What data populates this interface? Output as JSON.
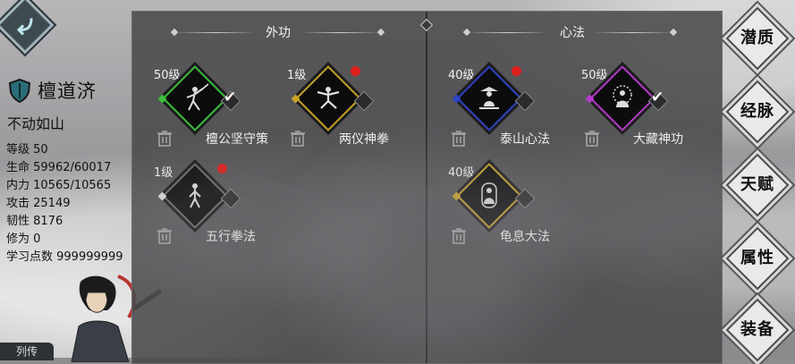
{
  "character": {
    "name": "檀道济",
    "title": "不动如山",
    "stats": [
      "等级 50",
      "生命 59962/60017",
      "内力 10565/10565",
      "攻击 25149",
      "韧性 8176",
      "修为 0",
      "学习点数 999999999"
    ],
    "bottom_label": "列传"
  },
  "sections": {
    "left_title": "外功",
    "right_title": "心法"
  },
  "skills": [
    {
      "level": "50级",
      "name": "檀公坚守策",
      "frame_color": "#3bbf3b",
      "equipped": true,
      "new": false
    },
    {
      "level": "1级",
      "name": "两仪神拳",
      "frame_color": "#c9a227",
      "equipped": false,
      "new": true
    },
    {
      "level": "1级",
      "name": "五行拳法",
      "frame_color": "#6d6d6d",
      "equipped": false,
      "new": true
    },
    {
      "level": "40级",
      "name": "泰山心法",
      "frame_color": "#2f43c4",
      "equipped": false,
      "new": true
    },
    {
      "level": "50级",
      "name": "大藏神功",
      "frame_color": "#b43bc9",
      "equipped": true,
      "new": false
    },
    {
      "level": "40级",
      "name": "龟息大法",
      "frame_color": "#c9a227",
      "equipped": false,
      "new": false
    }
  ],
  "nav": [
    "潜质",
    "经脉",
    "天赋",
    "属性",
    "装备"
  ]
}
